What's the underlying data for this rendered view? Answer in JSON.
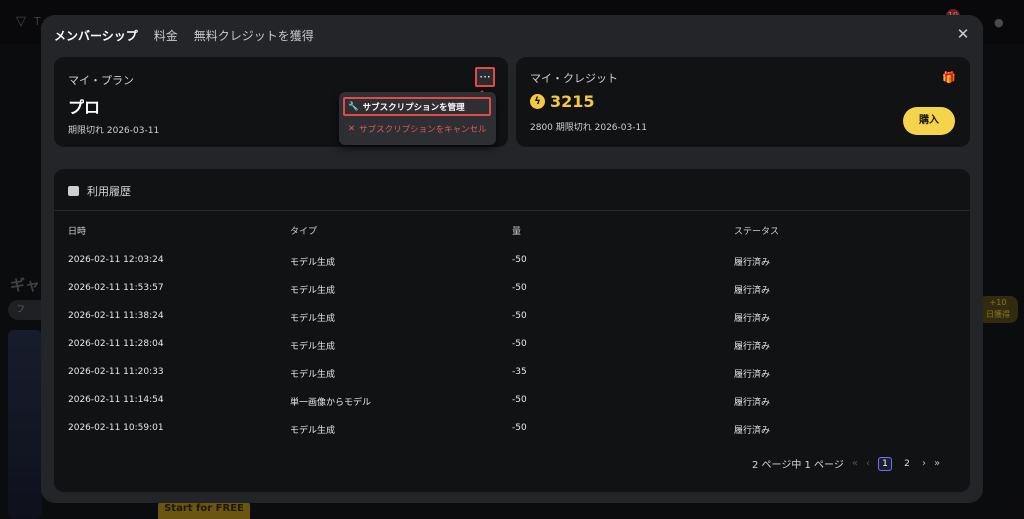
{
  "background": {
    "logo_text": "T",
    "notification_count": "10",
    "gallery_heading": "ギャ",
    "filter_chip": "フ",
    "promo_pill": "+10\n日獲得",
    "start_button": "Start for FREE"
  },
  "modal": {
    "tabs": [
      {
        "label": "メンバーシップ",
        "active": true
      },
      {
        "label": "料金",
        "active": false
      },
      {
        "label": "無料クレジットを獲得",
        "active": false
      }
    ],
    "close_icon": "close-icon"
  },
  "plan": {
    "label": "マイ・プラン",
    "name": "プロ",
    "expiry": "期限切れ 2026-03-11",
    "menu_button": "···",
    "menu": {
      "manage": "サブスクリプションを管理",
      "cancel": "サブスクリプションをキャンセル"
    }
  },
  "credit": {
    "label": "マイ・クレジット",
    "amount": "3215",
    "note": "2800 期限切れ 2026-03-11",
    "buy_label": "購入",
    "accent": "#f5c842"
  },
  "history": {
    "title": "利用履歴",
    "columns": [
      "日時",
      "タイプ",
      "量",
      "ステータス"
    ],
    "rows": [
      [
        "2026-02-11 12:03:24",
        "モデル生成",
        "-50",
        "履行済み"
      ],
      [
        "2026-02-11 11:53:57",
        "モデル生成",
        "-50",
        "履行済み"
      ],
      [
        "2026-02-11 11:38:24",
        "モデル生成",
        "-50",
        "履行済み"
      ],
      [
        "2026-02-11 11:28:04",
        "モデル生成",
        "-50",
        "履行済み"
      ],
      [
        "2026-02-11 11:20:33",
        "モデル生成",
        "-35",
        "履行済み"
      ],
      [
        "2026-02-11 11:14:54",
        "単一画像からモデル",
        "-50",
        "履行済み"
      ],
      [
        "2026-02-11 10:59:01",
        "モデル生成",
        "-50",
        "履行済み"
      ]
    ],
    "pagination": {
      "summary": "2 ページ中 1 ページ",
      "pages": [
        "1",
        "2"
      ],
      "current": "1"
    }
  }
}
